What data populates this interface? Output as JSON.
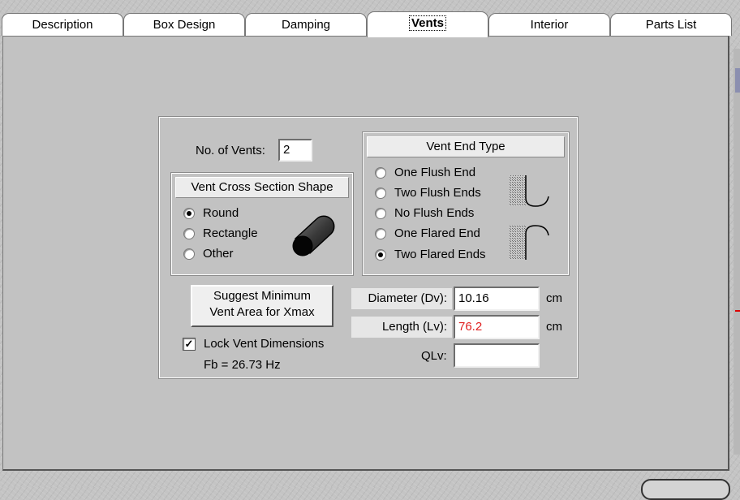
{
  "tabs": [
    {
      "label": "Description",
      "active": false
    },
    {
      "label": "Box Design",
      "active": false
    },
    {
      "label": "Damping",
      "active": false
    },
    {
      "label": "Vents",
      "active": true
    },
    {
      "label": "Interior",
      "active": false
    },
    {
      "label": "Parts List",
      "active": false
    }
  ],
  "vents": {
    "count_label": "No. of Vents:",
    "count_value": "2",
    "cross_section": {
      "title": "Vent Cross Section Shape",
      "options": [
        "Round",
        "Rectangle",
        "Other"
      ],
      "selected": "Round"
    },
    "end_type": {
      "title": "Vent End Type",
      "options": [
        "One Flush End",
        "Two Flush Ends",
        "No Flush Ends",
        "One Flared End",
        "Two Flared Ends"
      ],
      "selected": "Two Flared Ends"
    },
    "suggest_button": {
      "line1": "Suggest Minimum",
      "line2": "Vent Area for Xmax"
    },
    "lock_label": "Lock Vent Dimensions",
    "lock_checked": true,
    "fb_text": "Fb = 26.73 Hz",
    "diameter": {
      "label": "Diameter (Dv):",
      "value": "10.16",
      "unit": "cm"
    },
    "length": {
      "label": "Length (Lv):",
      "value": "76.2",
      "unit": "cm",
      "value_color": "#e02020"
    },
    "qlv": {
      "label": "QLv:",
      "value": ""
    }
  }
}
